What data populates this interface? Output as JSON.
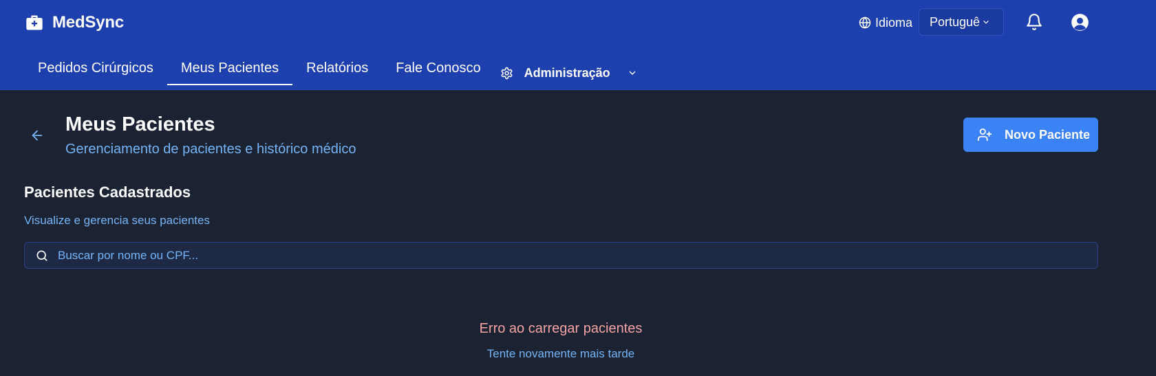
{
  "header": {
    "brand": "MedSync",
    "language_label": "Idioma",
    "language_value": "Português"
  },
  "nav": {
    "items": [
      {
        "label": "Pedidos Cirúrgicos"
      },
      {
        "label": "Meus Pacientes",
        "active": true
      },
      {
        "label": "Relatórios"
      },
      {
        "label": "Fale Conosco"
      }
    ],
    "admin_label": "Administração"
  },
  "page": {
    "title": "Meus Pacientes",
    "subtitle": "Gerenciamento de pacientes e histórico médico",
    "new_button_label": "Novo Paciente"
  },
  "section": {
    "title": "Pacientes Cadastrados",
    "description": "Visualize e gerencia seus pacientes",
    "search_placeholder": "Buscar por nome ou CPF..."
  },
  "status": {
    "error_title": "Erro ao carregar pacientes",
    "error_subtitle": "Tente novamente mais tarde"
  },
  "icons": [
    "briefcase-medical-icon",
    "globe-icon",
    "chevron-down-icon",
    "bell-icon",
    "user-circle-icon",
    "gear-icon",
    "arrow-left-icon",
    "user-plus-icon",
    "search-icon"
  ],
  "colors": {
    "header_bg": "#1e40af",
    "page_bg": "#1b2333",
    "accent": "#3b82f6",
    "muted_text": "#76b4f5",
    "error": "#f5a3a3"
  }
}
